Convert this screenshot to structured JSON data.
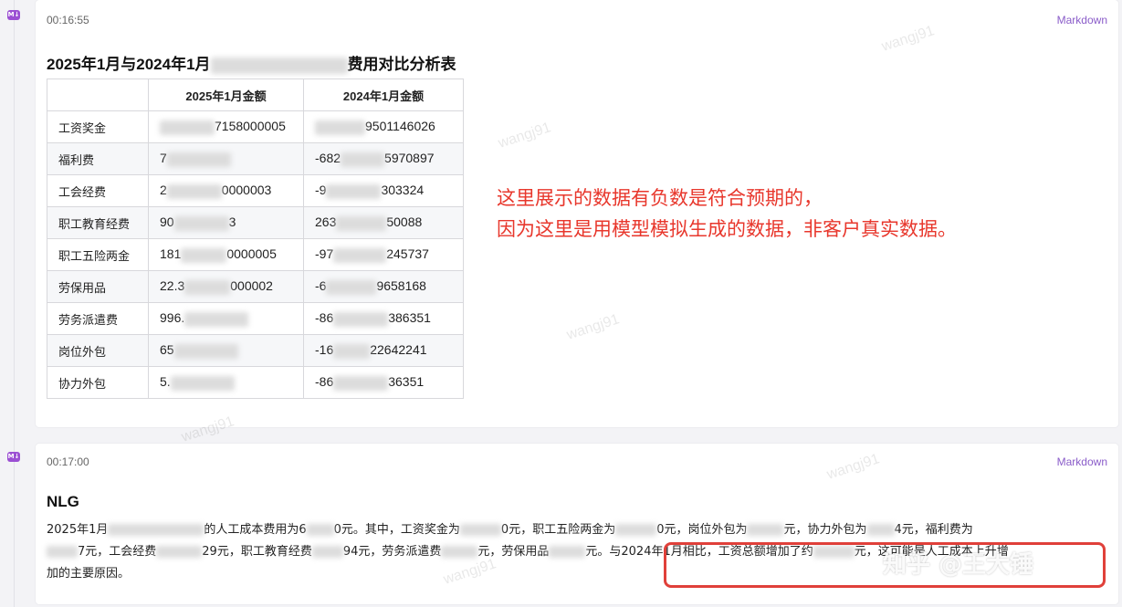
{
  "cells": [
    {
      "badge": "M↓",
      "time": "00:16:55",
      "type": "Markdown",
      "title_start": "2025年1月与2024年1月",
      "title_end": "费用对比分析表",
      "table": {
        "headers": [
          "",
          "2025年1月金额",
          "2024年1月金额"
        ],
        "rows": [
          {
            "category": "工资奖金",
            "a_pre": "",
            "a_post": "7158000005",
            "b_pre": "",
            "b_post": "9501146026"
          },
          {
            "category": "福利费",
            "a_pre": "7",
            "a_post": "",
            "b_pre": "-682",
            "b_post": "5970897"
          },
          {
            "category": "工会经费",
            "a_pre": "2",
            "a_post": "0000003",
            "b_pre": "-9",
            "b_post": "303324"
          },
          {
            "category": "职工教育经费",
            "a_pre": "90",
            "a_post": "3",
            "b_pre": "263",
            "b_post": "50088"
          },
          {
            "category": "职工五险两金",
            "a_pre": "181",
            "a_post": "0000005",
            "b_pre": "-97",
            "b_post": "245737"
          },
          {
            "category": "劳保用品",
            "a_pre": "22.3",
            "a_post": "000002",
            "b_pre": "-6",
            "b_post": "9658168"
          },
          {
            "category": "劳务派遣费",
            "a_pre": "996.",
            "a_post": "",
            "b_pre": "-86",
            "b_post": "386351"
          },
          {
            "category": "岗位外包",
            "a_pre": "65",
            "a_post": "",
            "b_pre": "-16",
            "b_post": "22642241"
          },
          {
            "category": "协力外包",
            "a_pre": "5.",
            "a_post": "",
            "b_pre": "-86",
            "b_post": "36351"
          }
        ]
      }
    },
    {
      "badge": "M↓",
      "time": "00:17:00",
      "type": "Markdown",
      "title": "NLG",
      "paragraph": {
        "l1": [
          "2025年1月",
          "的人工成本费用为6",
          "0元。其中，工资奖金为",
          "0元，职工五险两金为",
          "0元，岗位外包为",
          "元，协力外包为",
          "4元，福利费为"
        ],
        "l2": [
          "7元，工会经费",
          "29元，职工教育经费",
          "94元，劳务派遣费",
          "元，劳保用品",
          "元。与2024年1月相比，工资总额增加了约",
          "元，这可能是人工成本上升增"
        ],
        "l3": "加的主要原因。"
      }
    }
  ],
  "annotation": {
    "line1": "这里展示的数据有负数是符合预期的，",
    "line2": "因为这里是用模型模拟生成的数据，非客户真实数据。"
  },
  "watermark": "wangj91",
  "zhihu_mark": "知乎 @王大锤",
  "colors": {
    "annotation": "#e8372c",
    "badge": "#9b4fd3",
    "type_tag": "#8a5cc9",
    "highlight_box": "#e0403a"
  }
}
